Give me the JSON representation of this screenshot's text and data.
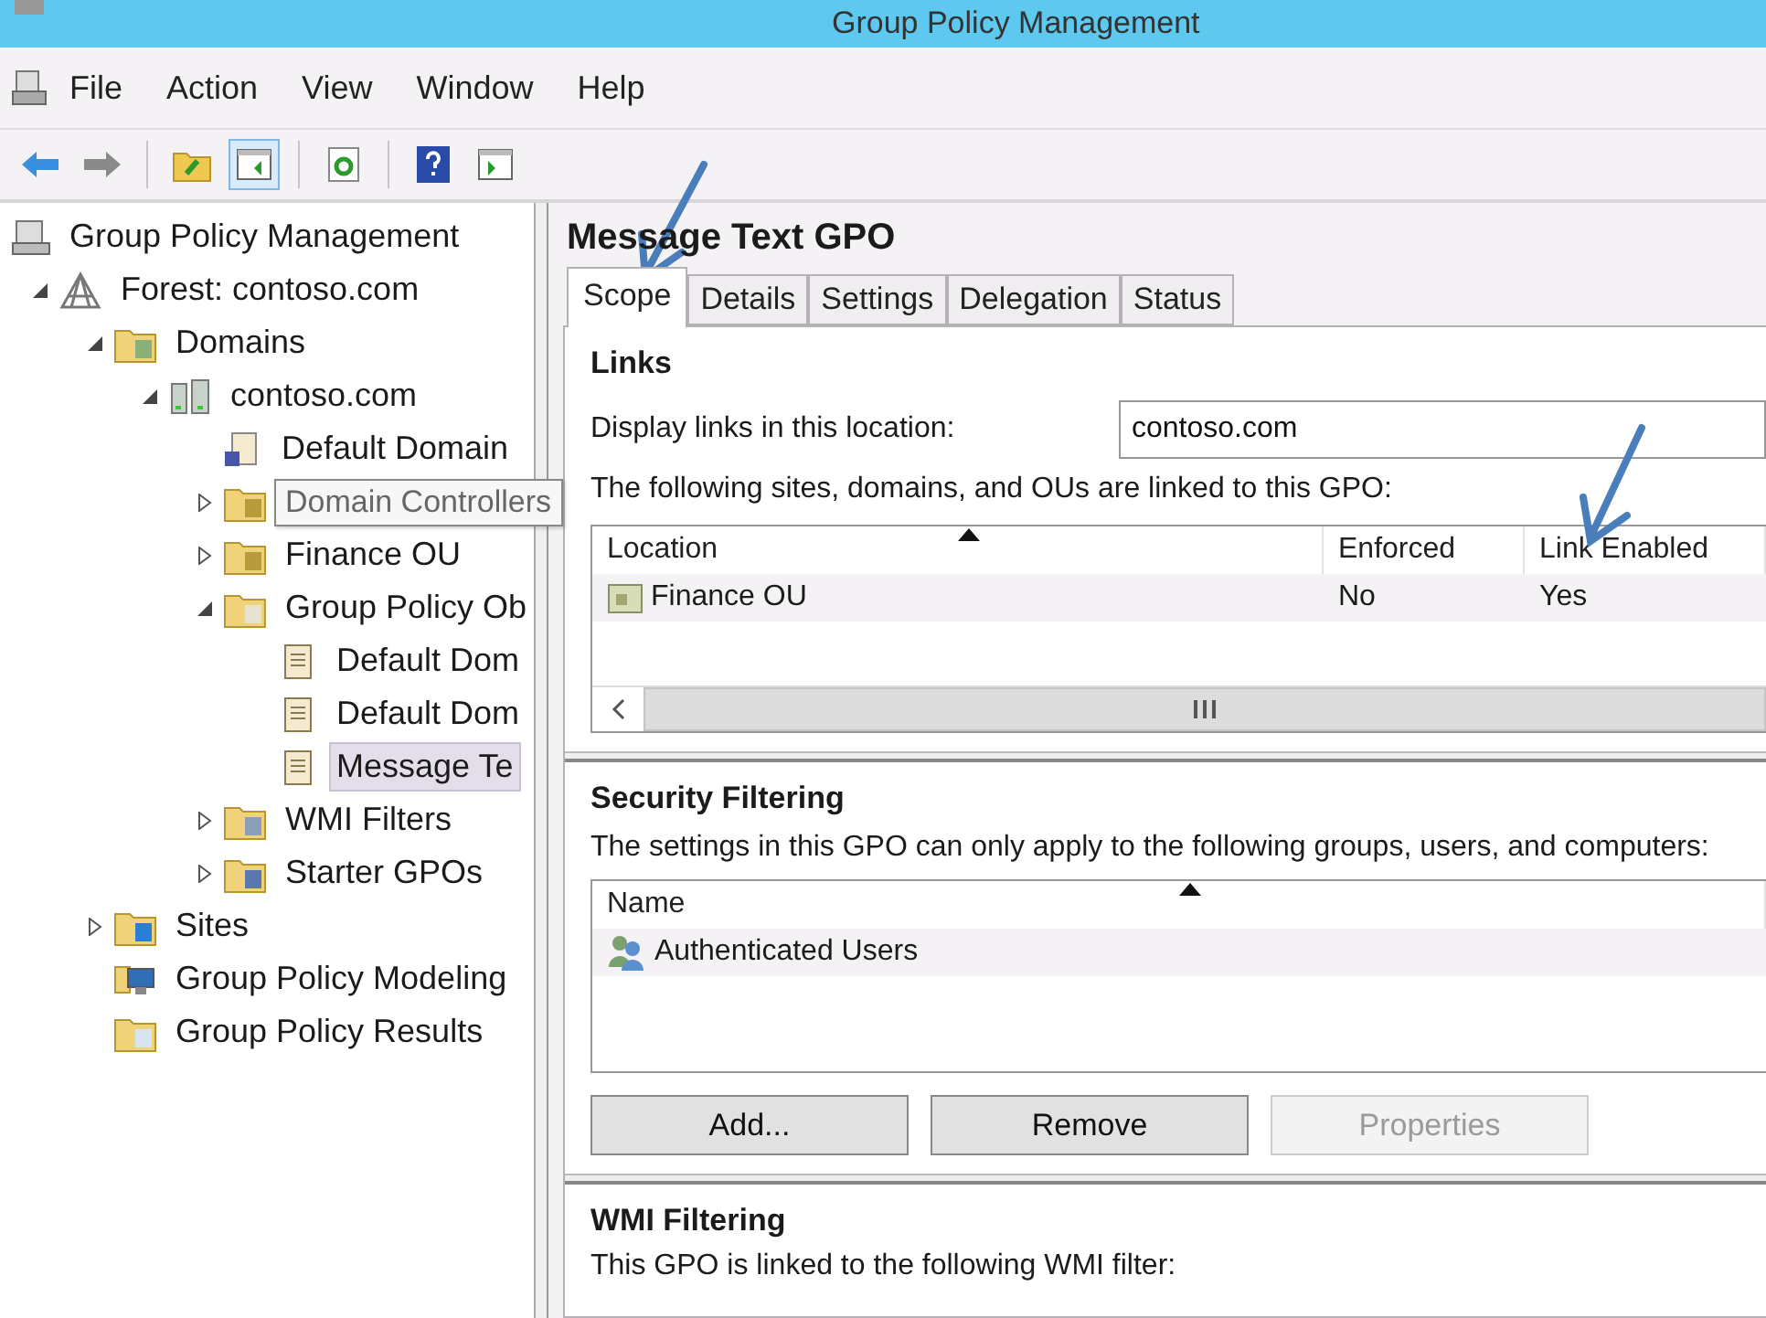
{
  "window": {
    "title": "Group Policy Management"
  },
  "menu": [
    "File",
    "Action",
    "View",
    "Window",
    "Help"
  ],
  "toolbar": [
    {
      "kind": "back",
      "pressed": false
    },
    {
      "kind": "forward",
      "pressed": false
    },
    {
      "kind": "sep"
    },
    {
      "kind": "up",
      "pressed": false
    },
    {
      "kind": "tree-pane",
      "pressed": true
    },
    {
      "kind": "sep"
    },
    {
      "kind": "refresh",
      "pressed": false
    },
    {
      "kind": "sep"
    },
    {
      "kind": "help",
      "pressed": false
    },
    {
      "kind": "action-pane",
      "pressed": false
    }
  ],
  "tree": {
    "label": "Group Policy Management",
    "kind": "console",
    "children": [
      {
        "label": "Forest: contoso.com",
        "kind": "forest",
        "expanded": true,
        "selected": false,
        "children": [
          {
            "label": "Domains",
            "kind": "domains",
            "expanded": true,
            "selected": false,
            "children": [
              {
                "label": "contoso.com",
                "kind": "domain",
                "expanded": true,
                "selected": false,
                "children": [
                  {
                    "label": "Default Domain",
                    "kind": "gpo-link",
                    "selected": false
                  },
                  {
                    "kind": "ou",
                    "expanded": false
                  },
                  {
                    "label": "Finance OU",
                    "kind": "ou",
                    "expanded": false,
                    "selected": false
                  },
                  {
                    "label": "Group Policy Ob",
                    "kind": "gpo-folder",
                    "expanded": true,
                    "selected": false,
                    "children": [
                      {
                        "label": "Default Dom",
                        "kind": "gpo",
                        "selected": false
                      },
                      {
                        "label": "Default Dom",
                        "kind": "gpo",
                        "selected": false
                      },
                      {
                        "label": "Message Te",
                        "kind": "gpo",
                        "selected": true
                      }
                    ]
                  },
                  {
                    "label": "WMI Filters",
                    "kind": "wmi",
                    "expanded": false,
                    "selected": false
                  },
                  {
                    "label": "Starter GPOs",
                    "kind": "starter",
                    "expanded": false,
                    "selected": false
                  }
                ]
              }
            ]
          },
          {
            "label": "Sites",
            "kind": "sites",
            "expanded": false,
            "selected": false
          },
          {
            "label": "Group Policy Modeling",
            "kind": "modeling",
            "selected": false
          },
          {
            "label": "Group Policy Results",
            "kind": "results",
            "selected": false
          }
        ]
      }
    ]
  },
  "tooltip": {
    "text": "Domain Controllers"
  },
  "details": {
    "title": "Message Text GPO",
    "tabs": [
      {
        "label": "Scope",
        "selected": true
      },
      {
        "label": "Details",
        "selected": false
      },
      {
        "label": "Settings",
        "selected": false
      },
      {
        "label": "Delegation",
        "selected": false
      },
      {
        "label": "Status",
        "selected": false
      }
    ],
    "links": {
      "heading": "Links",
      "location_label": "Display links in this location:",
      "location_value": "contoso.com",
      "description": "The following sites, domains, and OUs are linked to this GPO:",
      "columns": [
        {
          "label": "Location",
          "sorted": true
        },
        {
          "label": "Enforced",
          "sorted": false
        },
        {
          "label": "Link Enabled",
          "sorted": false
        }
      ],
      "rows": [
        {
          "cells": [
            "Finance OU",
            "No",
            "Yes"
          ]
        }
      ]
    },
    "security": {
      "heading": "Security Filtering",
      "description": "The settings in this GPO can only apply to the following groups, users, and computers:",
      "columns": [
        {
          "label": "Name",
          "sorted": true
        }
      ],
      "rows": [
        {
          "cells": [
            "Authenticated Users"
          ]
        }
      ],
      "buttons": [
        {
          "label": "Add...",
          "disabled": false
        },
        {
          "label": "Remove",
          "disabled": false
        },
        {
          "label": "Properties",
          "disabled": true
        }
      ]
    },
    "wmi": {
      "heading": "WMI Filtering",
      "description": "This GPO is linked to the following WMI filter:"
    }
  }
}
